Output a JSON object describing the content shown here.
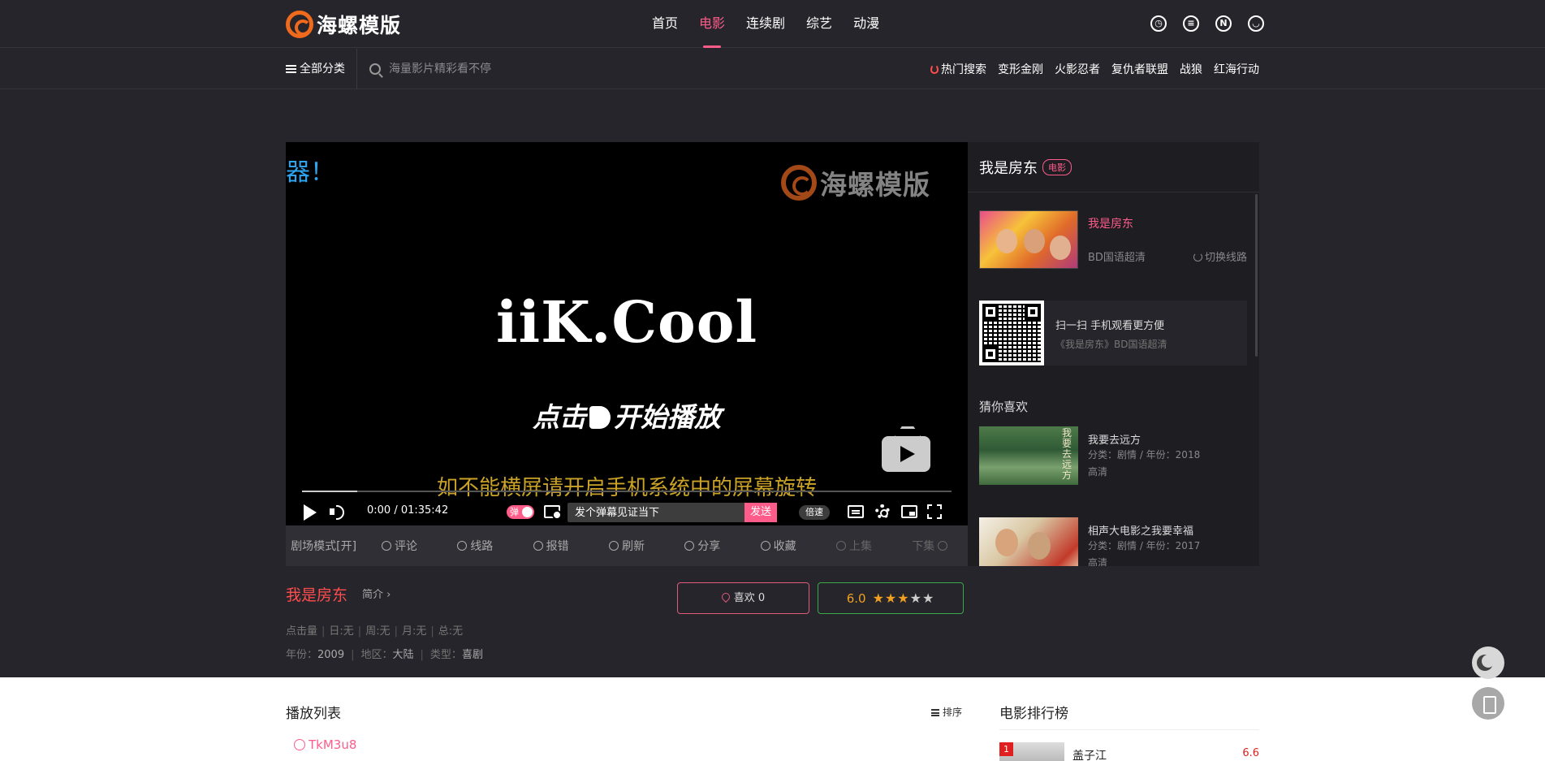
{
  "brand": {
    "logo_text": "海螺模版"
  },
  "nav": {
    "items": [
      "首页",
      "电影",
      "连续剧",
      "综艺",
      "动漫"
    ],
    "active": "电影"
  },
  "header_icons": [
    "history-icon",
    "message-icon",
    "notice-icon",
    "user-icon"
  ],
  "header_icon_n": "N",
  "subbar": {
    "all_categories": "全部分类",
    "search_placeholder": "海量影片精彩看不停",
    "hot_label": "热门搜索",
    "hot_terms": [
      "变形金刚",
      "火影忍者",
      "复仇者联盟",
      "战狼",
      "红海行动"
    ]
  },
  "player": {
    "danmu_text": "器！",
    "logo_text": "海螺模版",
    "brand_text": "iiK.Cool",
    "click_play_a": "点击",
    "click_play_b": "开始播放",
    "rotate_tip": "如不能横屏请开启手机系统中的屏幕旋转",
    "progress_fraction": 0.085,
    "time": "0:00 / 01:35:42",
    "danmu_toggle": "弹",
    "danmu_input_placeholder": "发个弹幕见证当下",
    "send_label": "发送",
    "speed_label": "倍速"
  },
  "actions": [
    {
      "label": "剧场模式[开]",
      "icon": "",
      "enabled": true
    },
    {
      "label": "评论",
      "icon": "comment-icon",
      "enabled": true
    },
    {
      "label": "线路",
      "icon": "route-icon",
      "enabled": true
    },
    {
      "label": "报错",
      "icon": "report-icon",
      "enabled": true
    },
    {
      "label": "刷新",
      "icon": "refresh-icon",
      "enabled": true
    },
    {
      "label": "分享",
      "icon": "share-icon",
      "enabled": true
    },
    {
      "label": "收藏",
      "icon": "star-icon",
      "enabled": true
    },
    {
      "label": "上集",
      "icon": "prev-icon",
      "enabled": false
    },
    {
      "label": "下集",
      "icon": "next-icon",
      "enabled": false
    }
  ],
  "sidebar": {
    "title": "我是房东",
    "tag": "电影",
    "current": {
      "title": "我是房东",
      "quality": "BD国语超清",
      "switch_label": "切换线路"
    },
    "qr": {
      "line1": "扫一扫 手机观看更方便",
      "line2": "《我是房东》BD国语超清"
    },
    "guess_title": "猜你喜欢",
    "recommend": [
      {
        "title": "我要去远方",
        "meta": "分类：剧情 / 年份：2018",
        "quality": "高清"
      },
      {
        "title": "相声大电影之我要幸福",
        "meta": "分类：剧情 / 年份：2017",
        "quality": "高清"
      }
    ]
  },
  "info": {
    "title": "我是房东",
    "intro": "简介",
    "stats": [
      "点击量",
      "日:无",
      "周:无",
      "月:无",
      "总:无"
    ],
    "year_label": "年份：",
    "year": "2009",
    "area_label": "地区：",
    "area": "大陆",
    "genre_label": "类型：",
    "genre": "喜剧",
    "like_label": "喜欢 0",
    "score": "6.0",
    "stars_on": 3,
    "stars_total": 5
  },
  "playlist": {
    "title": "播放列表",
    "sort_label": "排序",
    "source": "TkM3u8"
  },
  "ranking": {
    "title": "电影排行榜",
    "items": [
      {
        "rank": "1",
        "name": "盖子江",
        "score": "6.6"
      }
    ]
  }
}
